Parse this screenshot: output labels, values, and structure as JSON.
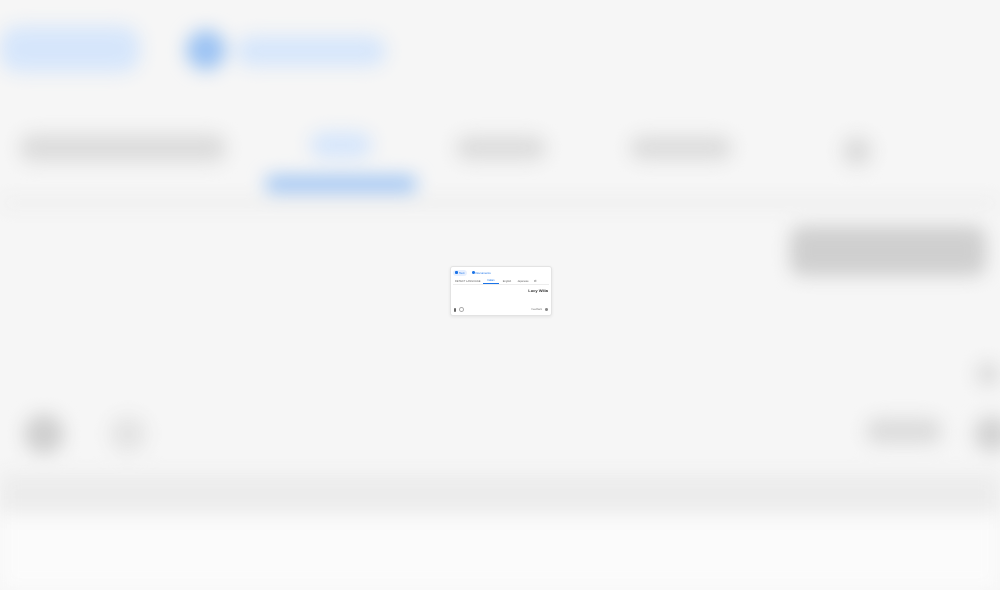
{
  "modes": [
    {
      "label": "Text",
      "icon": "translate-icon",
      "active": true
    },
    {
      "label": "Documents",
      "icon": "document-icon",
      "active": false
    }
  ],
  "languages": {
    "detect": "DETECT LANGUAGE",
    "source_items": [
      "Italian",
      "English",
      "Japanese"
    ],
    "swap": "⇄"
  },
  "output": {
    "text": "Lucy Wilia"
  },
  "counter": "",
  "footer": {
    "feedback": "Feedback"
  },
  "colors": {
    "accent": "#1a73e8",
    "background": "#f6f6f6"
  }
}
